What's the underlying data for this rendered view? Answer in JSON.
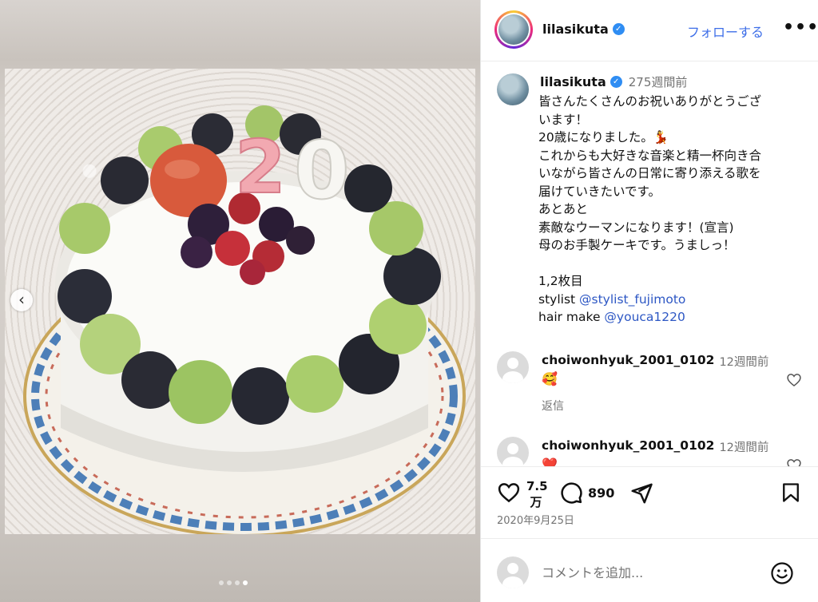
{
  "post": {
    "username": "lilasikuta",
    "follow_label": "フォローする",
    "more_label": "•••",
    "verified_mark": "✓"
  },
  "media": {
    "photo_alt": "Birthday cake with grapes, berries, macaron and candles 2 0",
    "candle_text": "20",
    "prev_arrow": "‹",
    "slide_count": 4,
    "active_slide": 4
  },
  "caption": {
    "username": "lilasikuta",
    "time": "275週間前",
    "lines": [
      "皆さんたくさんのお祝いありがとうござ",
      "います！",
      "20歳になりました。💃",
      "これからも大好きな音楽と精一杯向き合",
      "いながら皆さんの日常に寄り添える歌を",
      "届けていきたいです。",
      "あとあと",
      "素敵なウーマンになります！(宣言)",
      "母のお手製ケーキです。うましっ！",
      "",
      "1,2枚目"
    ],
    "stylist_prefix": "stylist ",
    "stylist_mention": "@stylist_fujimoto",
    "hair_prefix": "hair make ",
    "hair_mention": "@youca1220"
  },
  "comments": [
    {
      "username": "choiwonhyuk_2001_0102",
      "time": "12週間前",
      "text": "🥰",
      "reply_label": "返信"
    },
    {
      "username": "choiwonhyuk_2001_0102",
      "time": "12週間前",
      "text": "❤️"
    }
  ],
  "actions": {
    "likes_line1": "7.5",
    "likes_line2": "万",
    "comments_count": "890",
    "date": "2020年9月25日"
  },
  "add_comment": {
    "placeholder": "コメントを追加..."
  }
}
